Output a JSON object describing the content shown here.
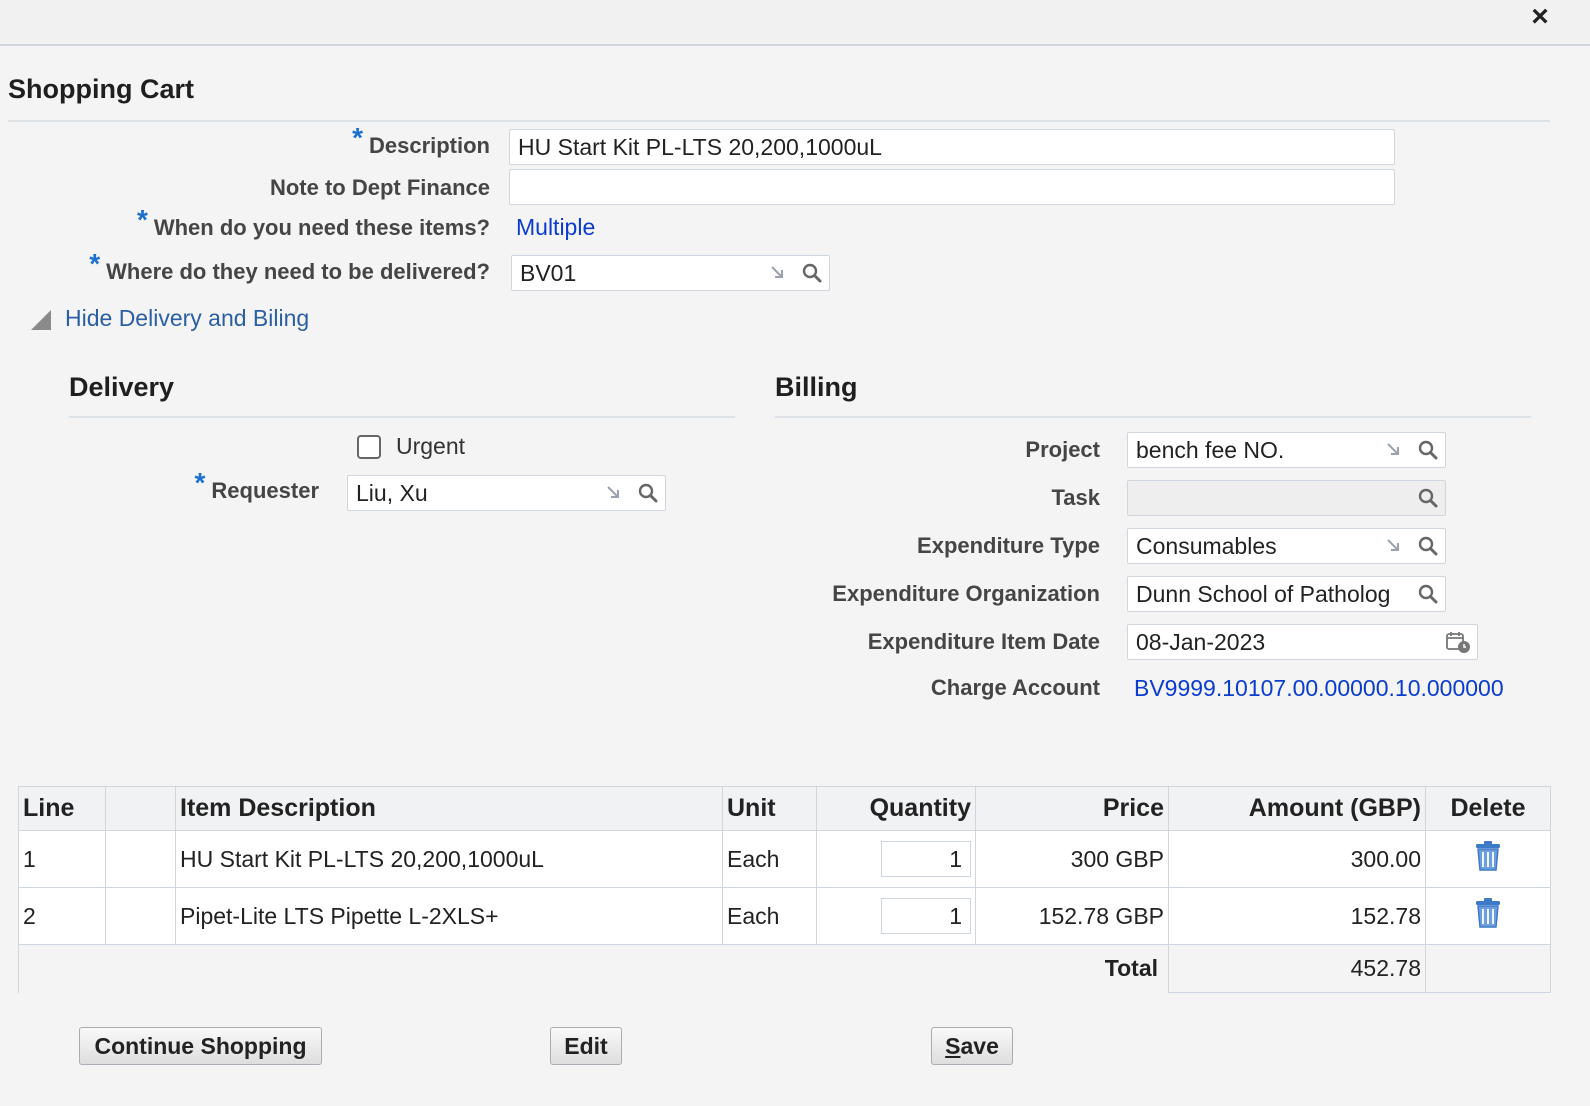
{
  "dialog": {
    "close_label": "×"
  },
  "page_title": "Shopping Cart",
  "form": {
    "description": {
      "label": "Description",
      "value": "HU Start Kit PL-LTS 20,200,1000uL"
    },
    "note": {
      "label": "Note to Dept Finance",
      "value": ""
    },
    "need_by": {
      "label": "When do you need these items?",
      "value": "Multiple"
    },
    "deliver_to": {
      "label": "Where do they need to be delivered?",
      "value": "BV01"
    },
    "toggle_label": "Hide Delivery and Biling",
    "required_marker": "*"
  },
  "delivery": {
    "title": "Delivery",
    "urgent_label": "Urgent",
    "urgent_checked": false,
    "requester_label": "Requester",
    "requester_value": "Liu, Xu"
  },
  "billing": {
    "title": "Billing",
    "project_label": "Project",
    "project_value": "bench fee NO.",
    "task_label": "Task",
    "task_value": "",
    "exp_type_label": "Expenditure Type",
    "exp_type_value": "Consumables",
    "exp_org_label": "Expenditure Organization",
    "exp_org_value": "Dunn School of Patholog",
    "exp_date_label": "Expenditure Item Date",
    "exp_date_value": "08-Jan-2023",
    "charge_label": "Charge Account",
    "charge_value": "BV9999.10107.00.00000.10.000000"
  },
  "table": {
    "headers": {
      "line": "Line",
      "blank": "",
      "item": "Item Description",
      "unit": "Unit",
      "qty": "Quantity",
      "price": "Price",
      "amount": "Amount (GBP)",
      "delete": "Delete"
    },
    "rows": [
      {
        "line": "1",
        "item": "HU Start Kit PL-LTS 20,200,1000uL",
        "unit": "Each",
        "qty": "1",
        "price": "300 GBP",
        "amount": "300.00"
      },
      {
        "line": "2",
        "item": "Pipet-Lite LTS Pipette L-2XLS+",
        "unit": "Each",
        "qty": "1",
        "price": "152.78 GBP",
        "amount": "152.78"
      }
    ],
    "total_label": "Total",
    "total_value": "452.78"
  },
  "buttons": {
    "continue": "Continue Shopping",
    "edit": "Edit",
    "save_first": "S",
    "save_rest": "ave"
  },
  "icons": {
    "close": "close-icon",
    "search": "search-icon",
    "lov_resize": "resize-arrow-icon",
    "calendar": "calendar-icon",
    "trash": "trash-icon",
    "triangle": "collapse-triangle-icon"
  },
  "colors": {
    "link": "#0b3ccf",
    "required": "#1a6fd1",
    "trash": "#3d79c6"
  }
}
